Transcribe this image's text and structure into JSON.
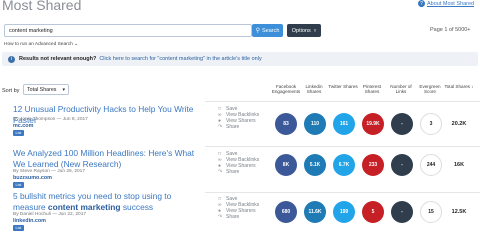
{
  "header": {
    "title": "Most Shared",
    "about_link": "About Most Shared"
  },
  "search": {
    "query": "content marketing",
    "search_button": "Search",
    "options_button": "Options",
    "page_count": "Page 1 of 5000+",
    "advanced_link": "How to run an Advanced Search"
  },
  "banner": {
    "bold_text": "Results not relevant enough?",
    "link_text": "Click here to search for \"content marketing\" in the article's title only"
  },
  "sort": {
    "label": "Sort by",
    "selected": "Total Shares"
  },
  "columns": [
    "Facebook Engagements",
    "Linkedin Shares",
    "Twitter Shares",
    "Pinterest Shares",
    "Number of Links",
    "Evergreen Score",
    "Total Shares"
  ],
  "actions": {
    "save": "Save",
    "view_backlinks": "View Backlinks",
    "view_sharers": "View Sharers",
    "share": "Share"
  },
  "results": [
    {
      "title": "12 Unusual Productivity Hacks to Help You Write Faster",
      "byline": "By Jonia Thompson — Jun 8, 2017",
      "domain": "mc.com",
      "badge": "List",
      "facebook": "83",
      "linkedin": "110",
      "twitter": "161",
      "pinterest": "19.9K",
      "links": "-",
      "evergreen": "3",
      "total": "20.2K"
    },
    {
      "title": "We Analyzed 100 Million Headlines: Here's What We Learned (New Research)",
      "byline": "By Steve Rayson — Jun 26, 2017",
      "domain": "buzzsumo.com",
      "badge": "List",
      "facebook": "8K",
      "linkedin": "5.1K",
      "twitter": "6.7K",
      "pinterest": "233",
      "links": "-",
      "evergreen": "244",
      "total": "16K"
    },
    {
      "title_plain_1": "5 bullshit metrics you need to stop using to measure",
      "title_bold": "content marketing",
      "title_plain_2": "success",
      "byline": "By Daniel Hochuli — Jun 22, 2017",
      "domain": "linkedin.com",
      "badge": "List",
      "facebook": "680",
      "linkedin": "11.6K",
      "twitter": "199",
      "pinterest": "5",
      "links": "-",
      "evergreen": "15",
      "total": "12.5K"
    }
  ],
  "colors": {
    "facebook": "#3b5898",
    "linkedin": "#1e7bb6",
    "twitter": "#21a5e8",
    "pinterest": "#c61f25",
    "links": "#2f3d4d",
    "accent": "#3d8fd9"
  }
}
